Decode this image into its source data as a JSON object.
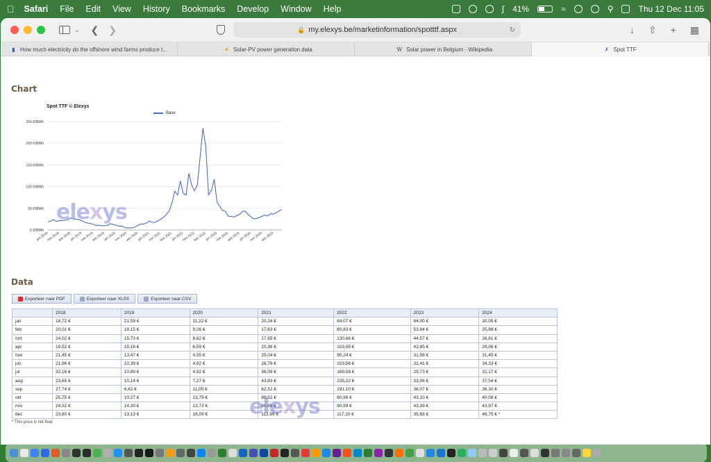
{
  "menubar": {
    "app": "Safari",
    "items": [
      "File",
      "Edit",
      "View",
      "History",
      "Bookmarks",
      "Develop",
      "Window",
      "Help"
    ],
    "battery": "41%",
    "datetime": "Thu 12 Dec  11:05"
  },
  "toolbar": {
    "url": "my.elexys.be/marketinformation/spotttf.aspx"
  },
  "tabs": [
    {
      "title": "How much electricity do the offshore wind farms produce t...",
      "icon": "bookmark-icon"
    },
    {
      "title": "Solar-PV power generation data",
      "icon": "sun-icon"
    },
    {
      "title": "Solar power in Belgium - Wikipedia",
      "icon": "wikipedia-icon"
    },
    {
      "title": "Spot TTF",
      "icon": "elexys-icon"
    }
  ],
  "page": {
    "chart_heading": "Chart",
    "data_heading": "Data",
    "watermark": {
      "part1": "ele",
      "part2": "x",
      "part3": "ys"
    },
    "export_buttons": [
      "Exporteer naar PDF",
      "Exporteer naar XLSX",
      "Exporteer naar CSV"
    ],
    "footnote": "* This price is not final"
  },
  "chart_data": {
    "type": "line",
    "title": "Spot TTF © Elexys",
    "series": [
      {
        "name": "Base"
      }
    ],
    "y_ticks": [
      "0 €/MWh",
      "50 €/MWh",
      "100 €/MWh",
      "150 €/MWh",
      "200 €/MWh",
      "250 €/MWh"
    ],
    "ylim": [
      0,
      250
    ],
    "x_ticks": [
      "jan 2018",
      "mei 2018",
      "sep 2018",
      "jan 2019",
      "mei 2019",
      "sep 2019",
      "jan 2020",
      "mei 2020",
      "sep 2020",
      "jan 2021",
      "mei 2021",
      "sep 2021",
      "jan 2022",
      "mei 2022",
      "sep 2022",
      "jan 2023",
      "mei 2023",
      "sep 2023",
      "jan 2024",
      "mei 2024",
      "sep 2024"
    ],
    "values": [
      18.72,
      20.01,
      24.02,
      19.52,
      21.45,
      21.96,
      22.16,
      23.65,
      27.74,
      25.75,
      24.52,
      23.8,
      21.59,
      18.15,
      15.73,
      15.16,
      13.47,
      10.39,
      10.89,
      10.14,
      9.62,
      10.27,
      14.3,
      13.13,
      11.22,
      9.26,
      8.62,
      6.59,
      4.55,
      4.92,
      4.92,
      7.27,
      11.05,
      13.79,
      13.73,
      16.09,
      20.34,
      17.63,
      17.65,
      20.36,
      25.04,
      28.79,
      36.09,
      43.83,
      62.52,
      89.52,
      80.69,
      112.99,
      84.07,
      80.83,
      130.66,
      103.05,
      90.24,
      103.56,
      169.58,
      235.22,
      191.1,
      80.96,
      90.99,
      117.1,
      64.0,
      53.84,
      44.57,
      42.85,
      31.58,
      31.41,
      29.73,
      33.06,
      36.07,
      43.1,
      43.39,
      35.63,
      30.05,
      25.88,
      26.61,
      29.06,
      31.45,
      34.33,
      32.17,
      37.54,
      36.3,
      40.08,
      43.97,
      46.75
    ],
    "grid": true,
    "legend": "top"
  },
  "table": {
    "headers": [
      "",
      "2018",
      "2019",
      "2020",
      "2021",
      "2022",
      "2023",
      "2024"
    ],
    "rows": [
      [
        "jan",
        "18,72 €",
        "21,59 €",
        "11,22 €",
        "20,34 €",
        "84,07 €",
        "64,00 €",
        "30,05 €"
      ],
      [
        "feb",
        "20,01 €",
        "18,15 €",
        "9,26 €",
        "17,63 €",
        "80,83 €",
        "53,84 €",
        "25,88 €"
      ],
      [
        "mrt",
        "24,02 €",
        "15,73 €",
        "8,62 €",
        "17,65 €",
        "130,66 €",
        "44,57 €",
        "26,61 €"
      ],
      [
        "apr",
        "19,52 €",
        "15,16 €",
        "6,59 €",
        "20,36 €",
        "103,05 €",
        "42,85 €",
        "29,06 €"
      ],
      [
        "mei",
        "21,45 €",
        "13,47 €",
        "4,55 €",
        "25,04 €",
        "90,24 €",
        "31,58 €",
        "31,45 €"
      ],
      [
        "jun",
        "21,96 €",
        "10,39 €",
        "4,92 €",
        "28,79 €",
        "103,56 €",
        "31,41 €",
        "34,33 €"
      ],
      [
        "jul",
        "22,16 €",
        "10,89 €",
        "4,92 €",
        "36,09 €",
        "169,58 €",
        "29,73 €",
        "32,17 €"
      ],
      [
        "aug",
        "23,65 €",
        "10,14 €",
        "7,27 €",
        "43,83 €",
        "235,22 €",
        "33,06 €",
        "37,54 €"
      ],
      [
        "sep",
        "27,74 €",
        "9,62 €",
        "11,05 €",
        "62,52 €",
        "191,10 €",
        "36,07 €",
        "36,30 €"
      ],
      [
        "okt",
        "25,75 €",
        "10,27 €",
        "13,79 €",
        "89,52 €",
        "80,96 €",
        "43,10 €",
        "40,08 €"
      ],
      [
        "nov",
        "24,52 €",
        "14,30 €",
        "13,73 €",
        "80,69 €",
        "90,99 €",
        "43,39 €",
        "43,97 €"
      ],
      [
        "dec",
        "23,80 €",
        "13,13 €",
        "16,09 €",
        "112,99 €",
        "117,10 €",
        "35,63 €",
        "46,75 € *"
      ]
    ]
  },
  "colors": {
    "line": "#4a6bc8",
    "heading": "#6b5a4a",
    "table_border": "#b9c6e0",
    "desktop": "#2e7d32"
  }
}
